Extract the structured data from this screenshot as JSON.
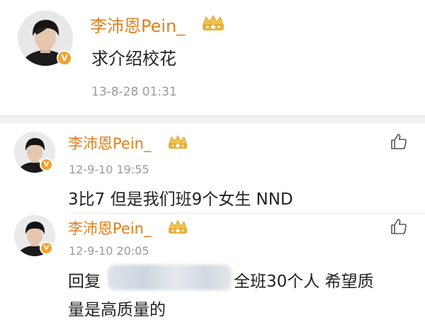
{
  "post": {
    "username": "李沛恩Pein_",
    "avatar_icon": "user-avatar-icon",
    "verified_badge": "V",
    "vip_badge_icon": "crown-icon",
    "content": "求介绍校花",
    "timestamp": "13-8-28 01:31"
  },
  "comments": [
    {
      "username": "李沛恩Pein_",
      "timestamp": "12-9-10 19:55",
      "content": "3比7 但是我们班9个女生 NND",
      "like_icon": "thumbs-up-icon",
      "verified_badge": "V"
    },
    {
      "username": "李沛恩Pein_",
      "timestamp": "12-9-10 20:05",
      "content_prefix": "回复",
      "content_suffix": "全班30个人 希望质",
      "content_line2": "量是高质量的",
      "like_icon": "thumbs-up-icon",
      "verified_badge": "V"
    }
  ],
  "colors": {
    "username": "#e27f1a",
    "meta": "#9b9b9b",
    "text": "#222222",
    "badge": "#f0a12e",
    "divider": "#f1f1f3"
  }
}
